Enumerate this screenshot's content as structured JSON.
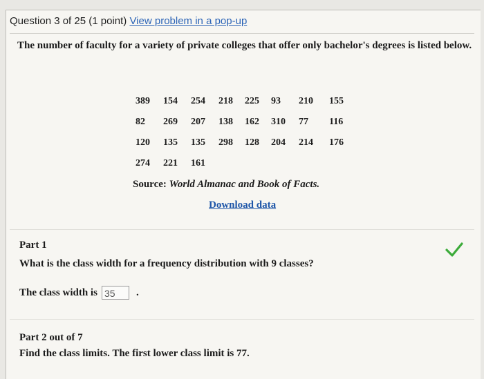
{
  "header": {
    "question_label": "Question 3 of 25 (1 point)",
    "popup_link": "View problem in a pop-up"
  },
  "intro": "The number of faculty for a variety of private colleges that offer only bachelor's degrees is listed below.",
  "data_rows": [
    [
      "389",
      "154",
      "254",
      "218",
      "225",
      "93",
      "210",
      "155"
    ],
    [
      "82",
      "269",
      "207",
      "138",
      "162",
      "310",
      "77",
      "116"
    ],
    [
      "120",
      "135",
      "135",
      "298",
      "128",
      "204",
      "214",
      "176"
    ],
    [
      "274",
      "221",
      "161"
    ]
  ],
  "source": {
    "label": "Source:",
    "title": "World Almanac and Book of Facts."
  },
  "download_label": "Download data",
  "part1": {
    "title": "Part 1",
    "question": "What is the class width for a frequency distribution with 9 classes?",
    "answer_prefix": "The class width is",
    "answer_value": "35",
    "answer_suffix": ".",
    "status_icon": "checkmark-icon",
    "status_color": "#3cab3a"
  },
  "part2": {
    "title": "Part 2 out of 7",
    "question": "Find the class limits. The first lower class limit is 77."
  }
}
